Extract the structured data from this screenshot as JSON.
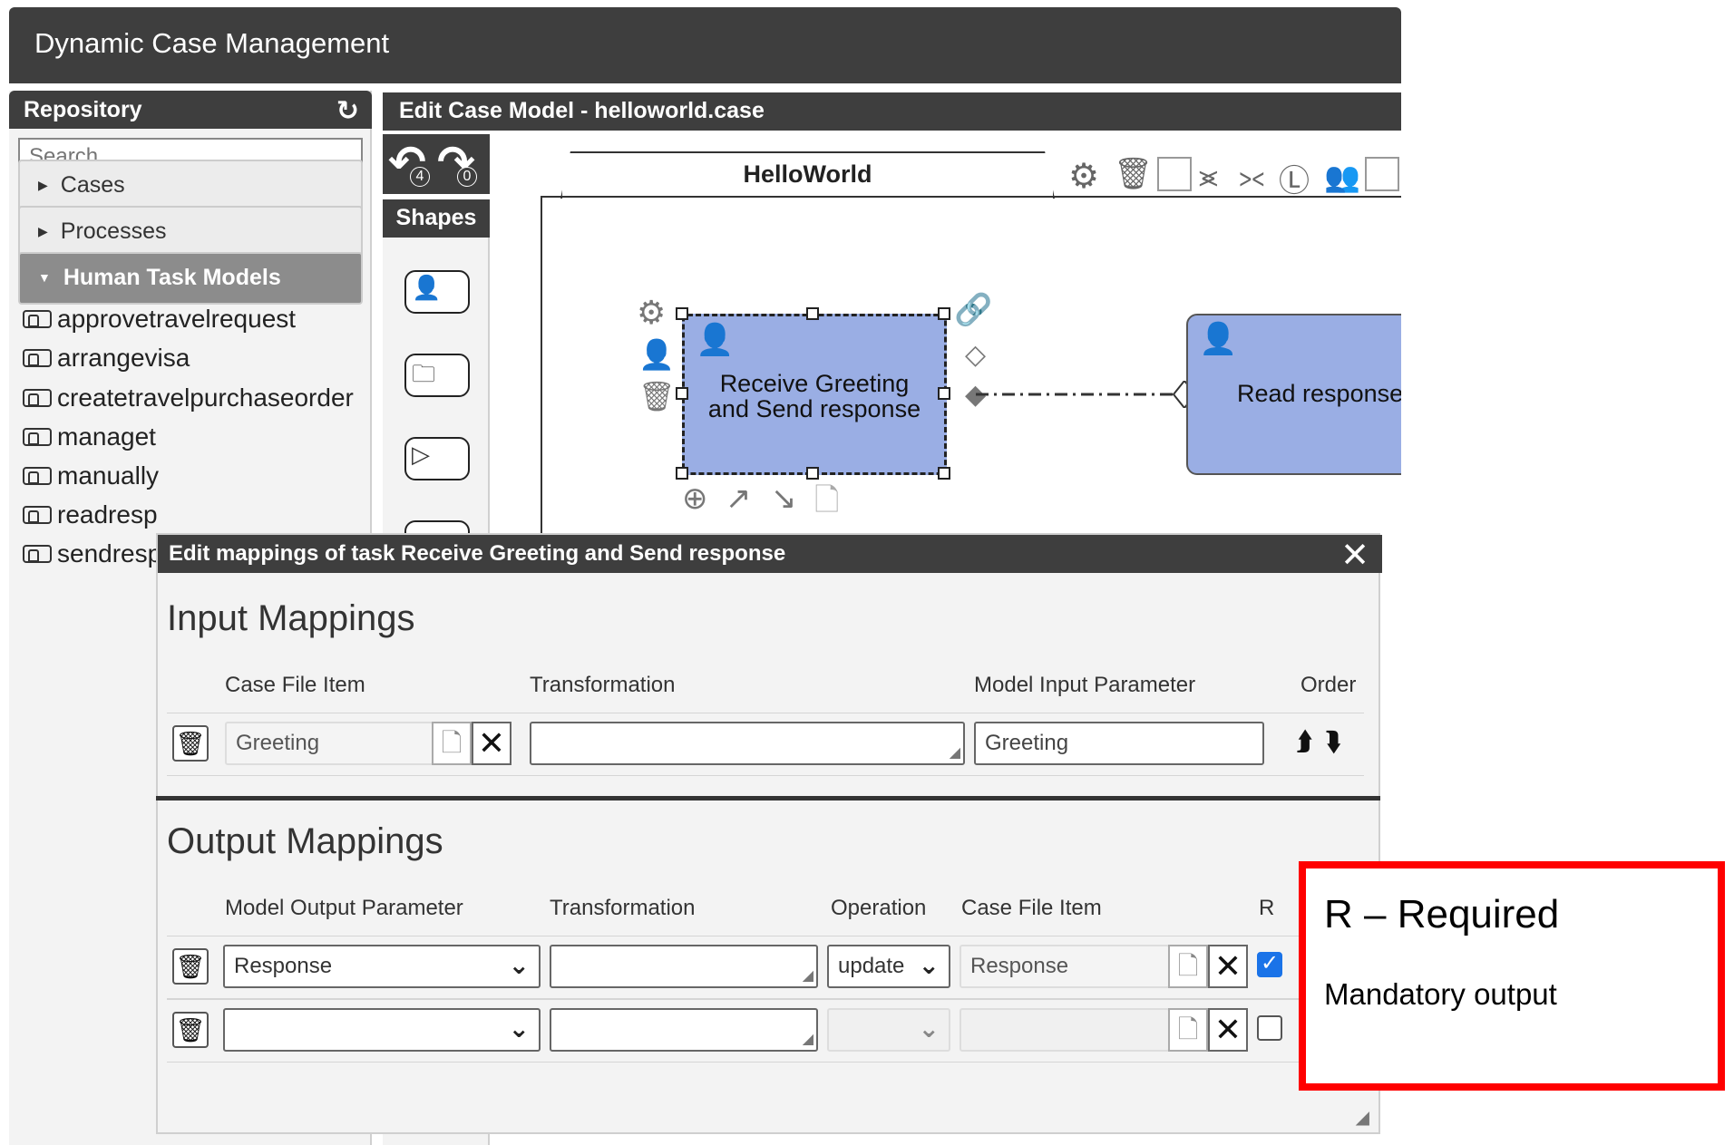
{
  "app": {
    "title": "Dynamic Case Management"
  },
  "repository": {
    "title": "Repository",
    "search_placeholder": "Search",
    "sections": [
      {
        "label": "Cases"
      },
      {
        "label": "Processes"
      },
      {
        "label": "Human Task Models"
      }
    ],
    "human_tasks": [
      "approvetravelrequest",
      "arrangevisa",
      "createtravelpurchaseorder",
      "managet",
      "manually",
      "readresp",
      "sendresp"
    ]
  },
  "editor": {
    "title": "Edit Case Model - helloworld.case",
    "undo_count": "4",
    "redo_count": "0",
    "shapes_label": "Shapes",
    "tab_label": "HelloWorld",
    "tasks": {
      "receive": "Receive Greeting and Send response",
      "read": "Read response"
    }
  },
  "modal": {
    "title": "Edit mappings of task Receive Greeting and Send response",
    "input": {
      "title": "Input Mappings",
      "columns": [
        "Case File Item",
        "Transformation",
        "Model Input Parameter",
        "Order"
      ],
      "rows": [
        {
          "case_file_item": "Greeting",
          "transformation": "",
          "model_input_parameter": "Greeting"
        }
      ]
    },
    "output": {
      "title": "Output Mappings",
      "columns": [
        "Model Output Parameter",
        "Transformation",
        "Operation",
        "Case File Item",
        "R"
      ],
      "rows": [
        {
          "model_output_parameter": "Response",
          "transformation": "",
          "operation": "update",
          "case_file_item": "Response",
          "required": true
        },
        {
          "model_output_parameter": "",
          "transformation": "",
          "operation": "",
          "case_file_item": "",
          "required": false
        }
      ]
    }
  },
  "annotation": {
    "title": "R – Required",
    "description": "Mandatory output"
  },
  "colors": {
    "dark_bar": "#3e3e3e",
    "task_fill": "#9aaee4",
    "annotation_border": "#ff0000",
    "checkbox_on": "#1a73e8"
  }
}
